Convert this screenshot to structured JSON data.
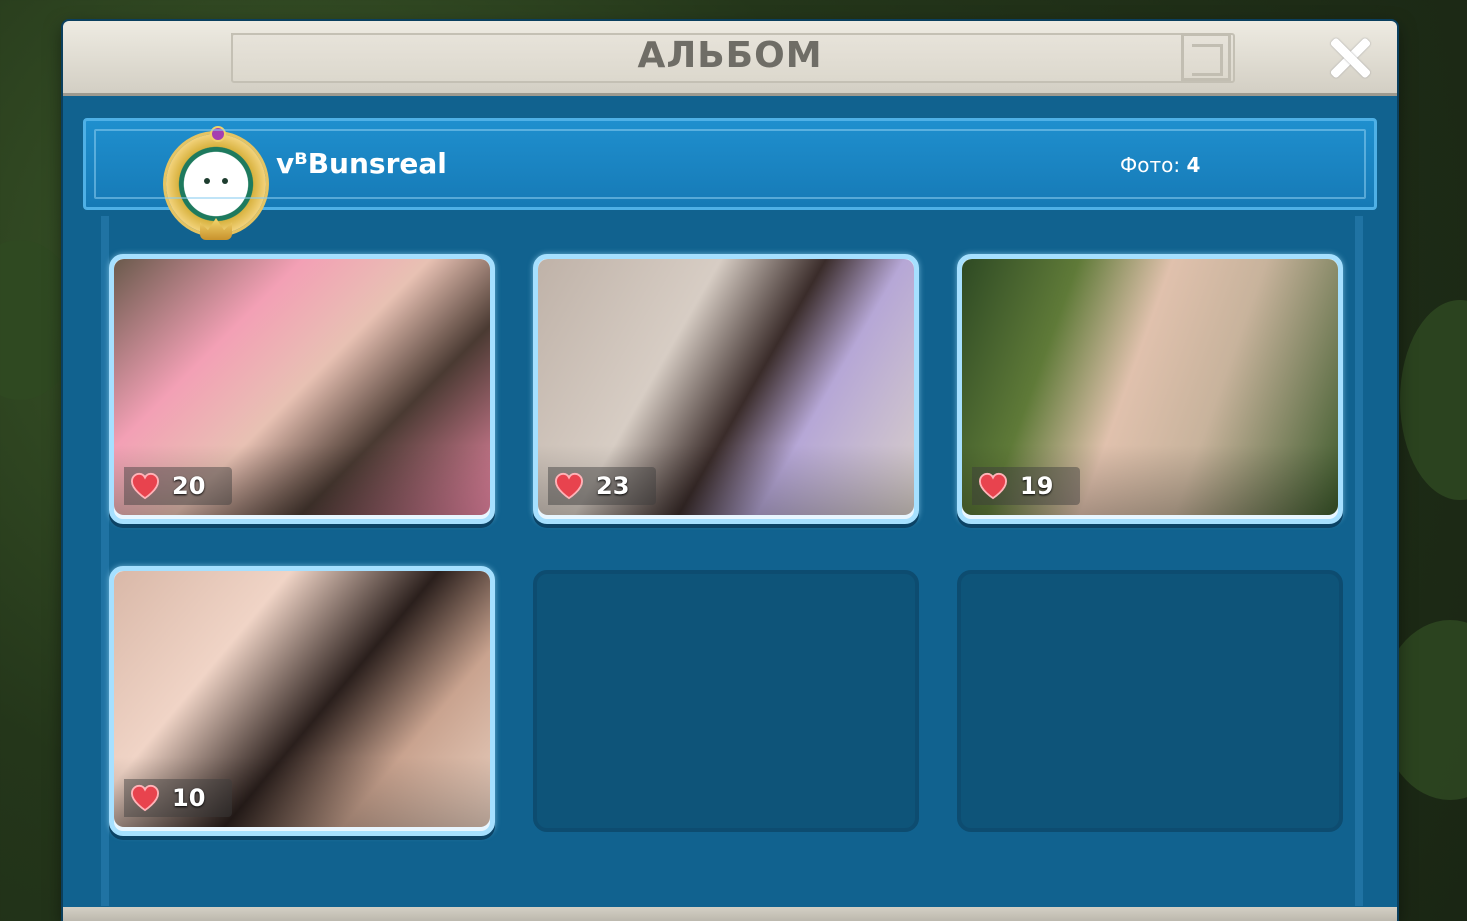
{
  "dialog": {
    "title": "АЛЬБОМ",
    "close_icon": "close-icon"
  },
  "profile": {
    "username": "vᴮBunsreal",
    "photos_label": "Фото:",
    "photos_count": "4",
    "avatar_icon": "avatar-crest"
  },
  "photos": [
    {
      "likes": "20",
      "heart_icon": "heart-icon"
    },
    {
      "likes": "23",
      "heart_icon": "heart-icon"
    },
    {
      "likes": "19",
      "heart_icon": "heart-icon"
    },
    {
      "likes": "10",
      "heart_icon": "heart-icon"
    }
  ],
  "empty_slots": 2,
  "colors": {
    "panel": "#11628f",
    "header_bar": "#1f8fce",
    "title_text": "#6f6d66",
    "heart": "#e8434e"
  }
}
